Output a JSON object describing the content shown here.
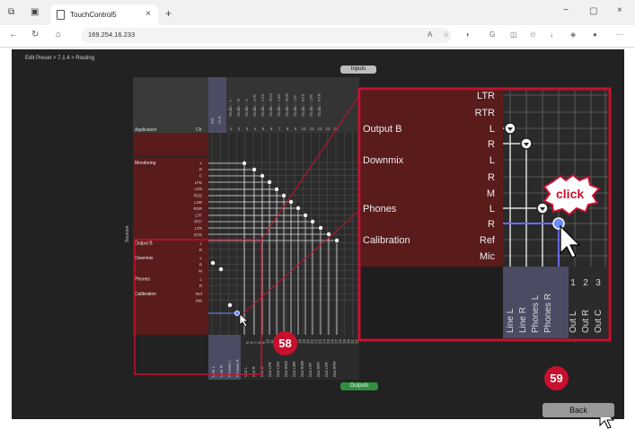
{
  "browser": {
    "tab_title": "TouchControl5",
    "tab_close": "×",
    "new_tab": "+",
    "url": "169.254.16.233",
    "window_min": "−",
    "window_max": "▢",
    "window_close": "×"
  },
  "app": {
    "breadcrumb": "Edit Preset > 7.1.4 > Routing",
    "inputs_label": "Inputs",
    "outputs_label": "Outputs",
    "sources_label": "Sources",
    "back_label": "Back",
    "col_application": "Application",
    "col_ch": "Ch",
    "groups": [
      {
        "name": "Monitoring",
        "channels": [
          "L",
          "R",
          "C",
          "LFE",
          "LSS",
          "RSS",
          "LSR",
          "RSR",
          "LTF",
          "RTF",
          "LTR",
          "RTR"
        ]
      },
      {
        "name": "Output B",
        "channels": [
          "L",
          "R"
        ]
      },
      {
        "name": "Downmix",
        "channels": [
          "L",
          "R",
          "M"
        ]
      },
      {
        "name": "Phones",
        "channels": [
          "L",
          "R"
        ]
      },
      {
        "name": "Calibration",
        "channels": [
          "Ref",
          "Mic"
        ]
      }
    ],
    "input_headers": [
      "Mic",
      "XLR"
    ],
    "input_studio": [
      "Studio - L",
      "Studio - R",
      "Studio - C",
      "Studio - LFE",
      "Studio - LSS",
      "Studio - RSS",
      "Studio - LSR",
      "Studio - RSR",
      "Studio - LTF",
      "Studio - RTF",
      "Studio - LTR",
      "Studio - RTR"
    ],
    "input_numbers": [
      "1",
      "2",
      "3",
      "4",
      "5",
      "6",
      "7",
      "8",
      "9",
      "10",
      "11",
      "12",
      "13",
      "14"
    ],
    "output_names": [
      "Line L",
      "Line R",
      "Phones L",
      "Phones R",
      "Out L",
      "Out R",
      "Out C",
      "Out LFE",
      "Out LSS",
      "Out RSS",
      "Out LSR",
      "Out RSR",
      "Out LTF",
      "Out RTF",
      "Out LTR",
      "Out RTR"
    ],
    "output_numbers": [
      "1",
      "2",
      "3",
      "4",
      "5",
      "6",
      "7",
      "8",
      "9",
      "10",
      "11",
      "12",
      "13",
      "14",
      "15",
      "16",
      "17",
      "18",
      "19",
      "20",
      "21",
      "22",
      "23",
      "24",
      "25",
      "26",
      "27",
      "28",
      "29",
      "30",
      "31",
      "32"
    ]
  },
  "zoom": {
    "channels": [
      "LTR",
      "RTR",
      "L",
      "R",
      "L",
      "R",
      "M",
      "L",
      "R",
      "Ref",
      "Mic"
    ],
    "groups": [
      "Output B",
      "Downmix",
      "Phones",
      "Calibration"
    ],
    "outputs": [
      "Line L",
      "Line R",
      "Phones L",
      "Phones R",
      "Out L",
      "Out R",
      "Out C"
    ],
    "numbers": [
      "1",
      "2",
      "3"
    ],
    "click_label": "click"
  },
  "callouts": {
    "badge_58": "58",
    "badge_59": "59"
  },
  "colors": {
    "accent": "#c8102e",
    "row_group": "#5a1b1b",
    "selected_node": "#6b8cff",
    "outputs_tab": "#2f8e3f"
  }
}
